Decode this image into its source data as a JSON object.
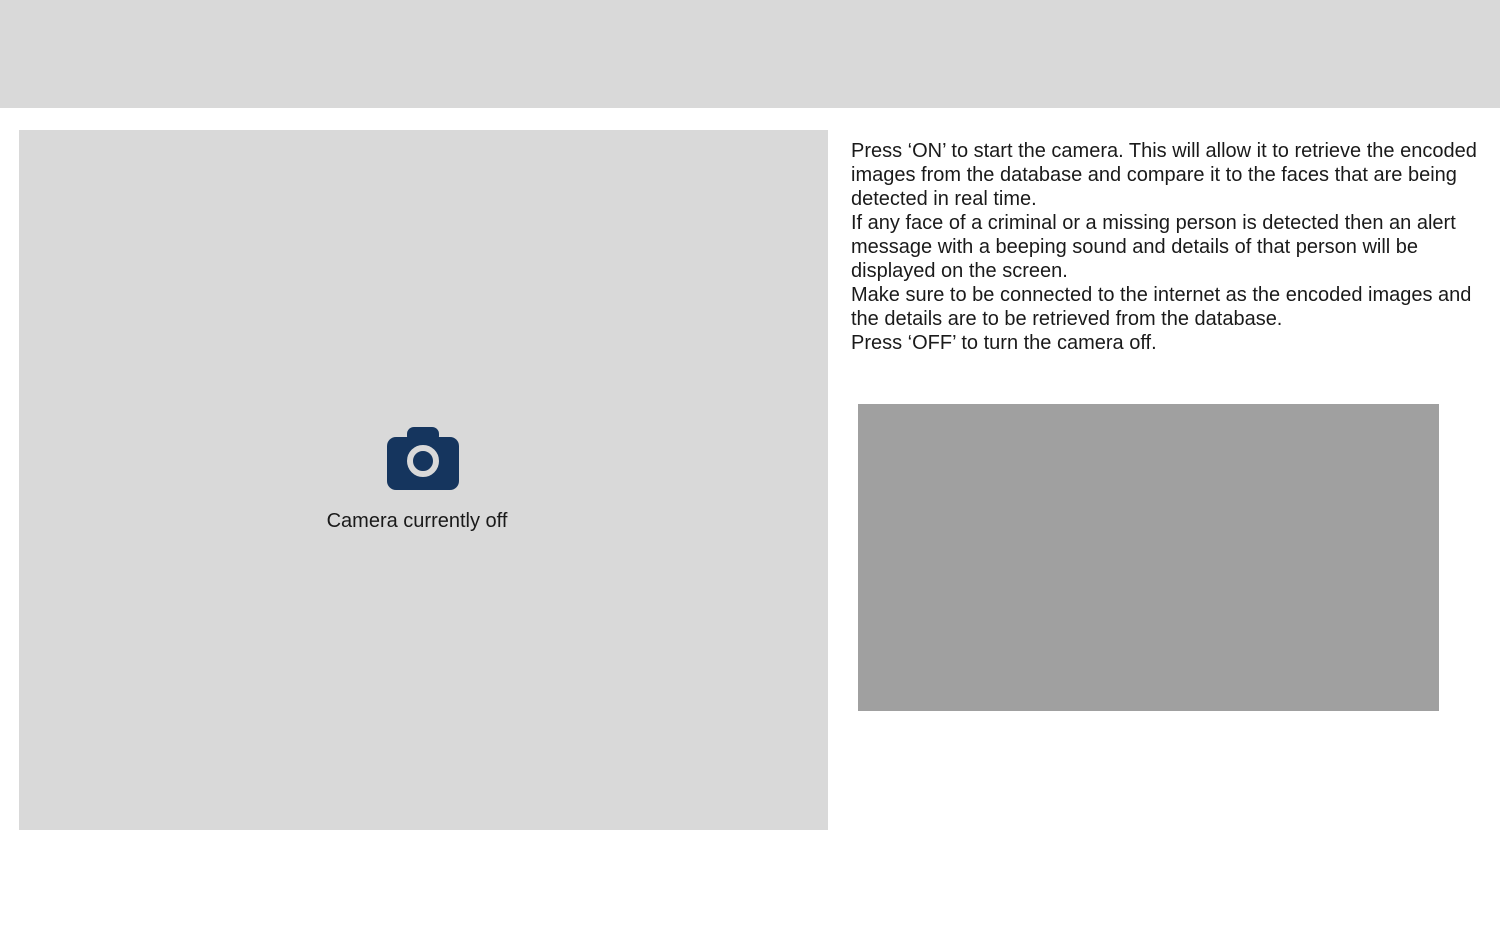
{
  "camera": {
    "status_text": "Camera currently off",
    "icon": "camera-icon"
  },
  "instructions": {
    "lines": [
      "Press ‘ON’ to start the camera. This will allow it to retrieve the encoded images from the database and compare it to the faces that are being detected in real time.",
      "If any face of a criminal or a missing person is detected then an alert message with a beeping sound and details of that person will be displayed on the screen.",
      "Make sure to be connected to the internet as the encoded images and the details are to be retrieved from the database.",
      "Press ‘OFF’ to turn the camera off."
    ]
  },
  "colors": {
    "panel_background": "#d9d9d9",
    "alert_box": "#a0a0a0",
    "icon": "#15355e",
    "text": "#1a1a1a"
  }
}
